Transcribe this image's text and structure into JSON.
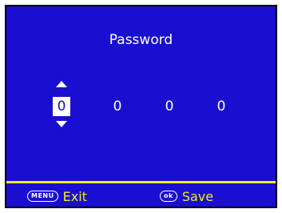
{
  "screen": {
    "title": "Password",
    "digits": [
      "0",
      "0",
      "0",
      "0"
    ],
    "selected_index": 0
  },
  "footer": {
    "exit_key": "MENU",
    "exit_label": "Exit",
    "save_key": "ok",
    "save_label": "Save"
  },
  "colors": {
    "background": "#1a0fd0",
    "highlight": "#ffffff",
    "accent": "#f2ea25"
  },
  "icons": [
    "up-arrow-icon",
    "down-arrow-icon"
  ]
}
